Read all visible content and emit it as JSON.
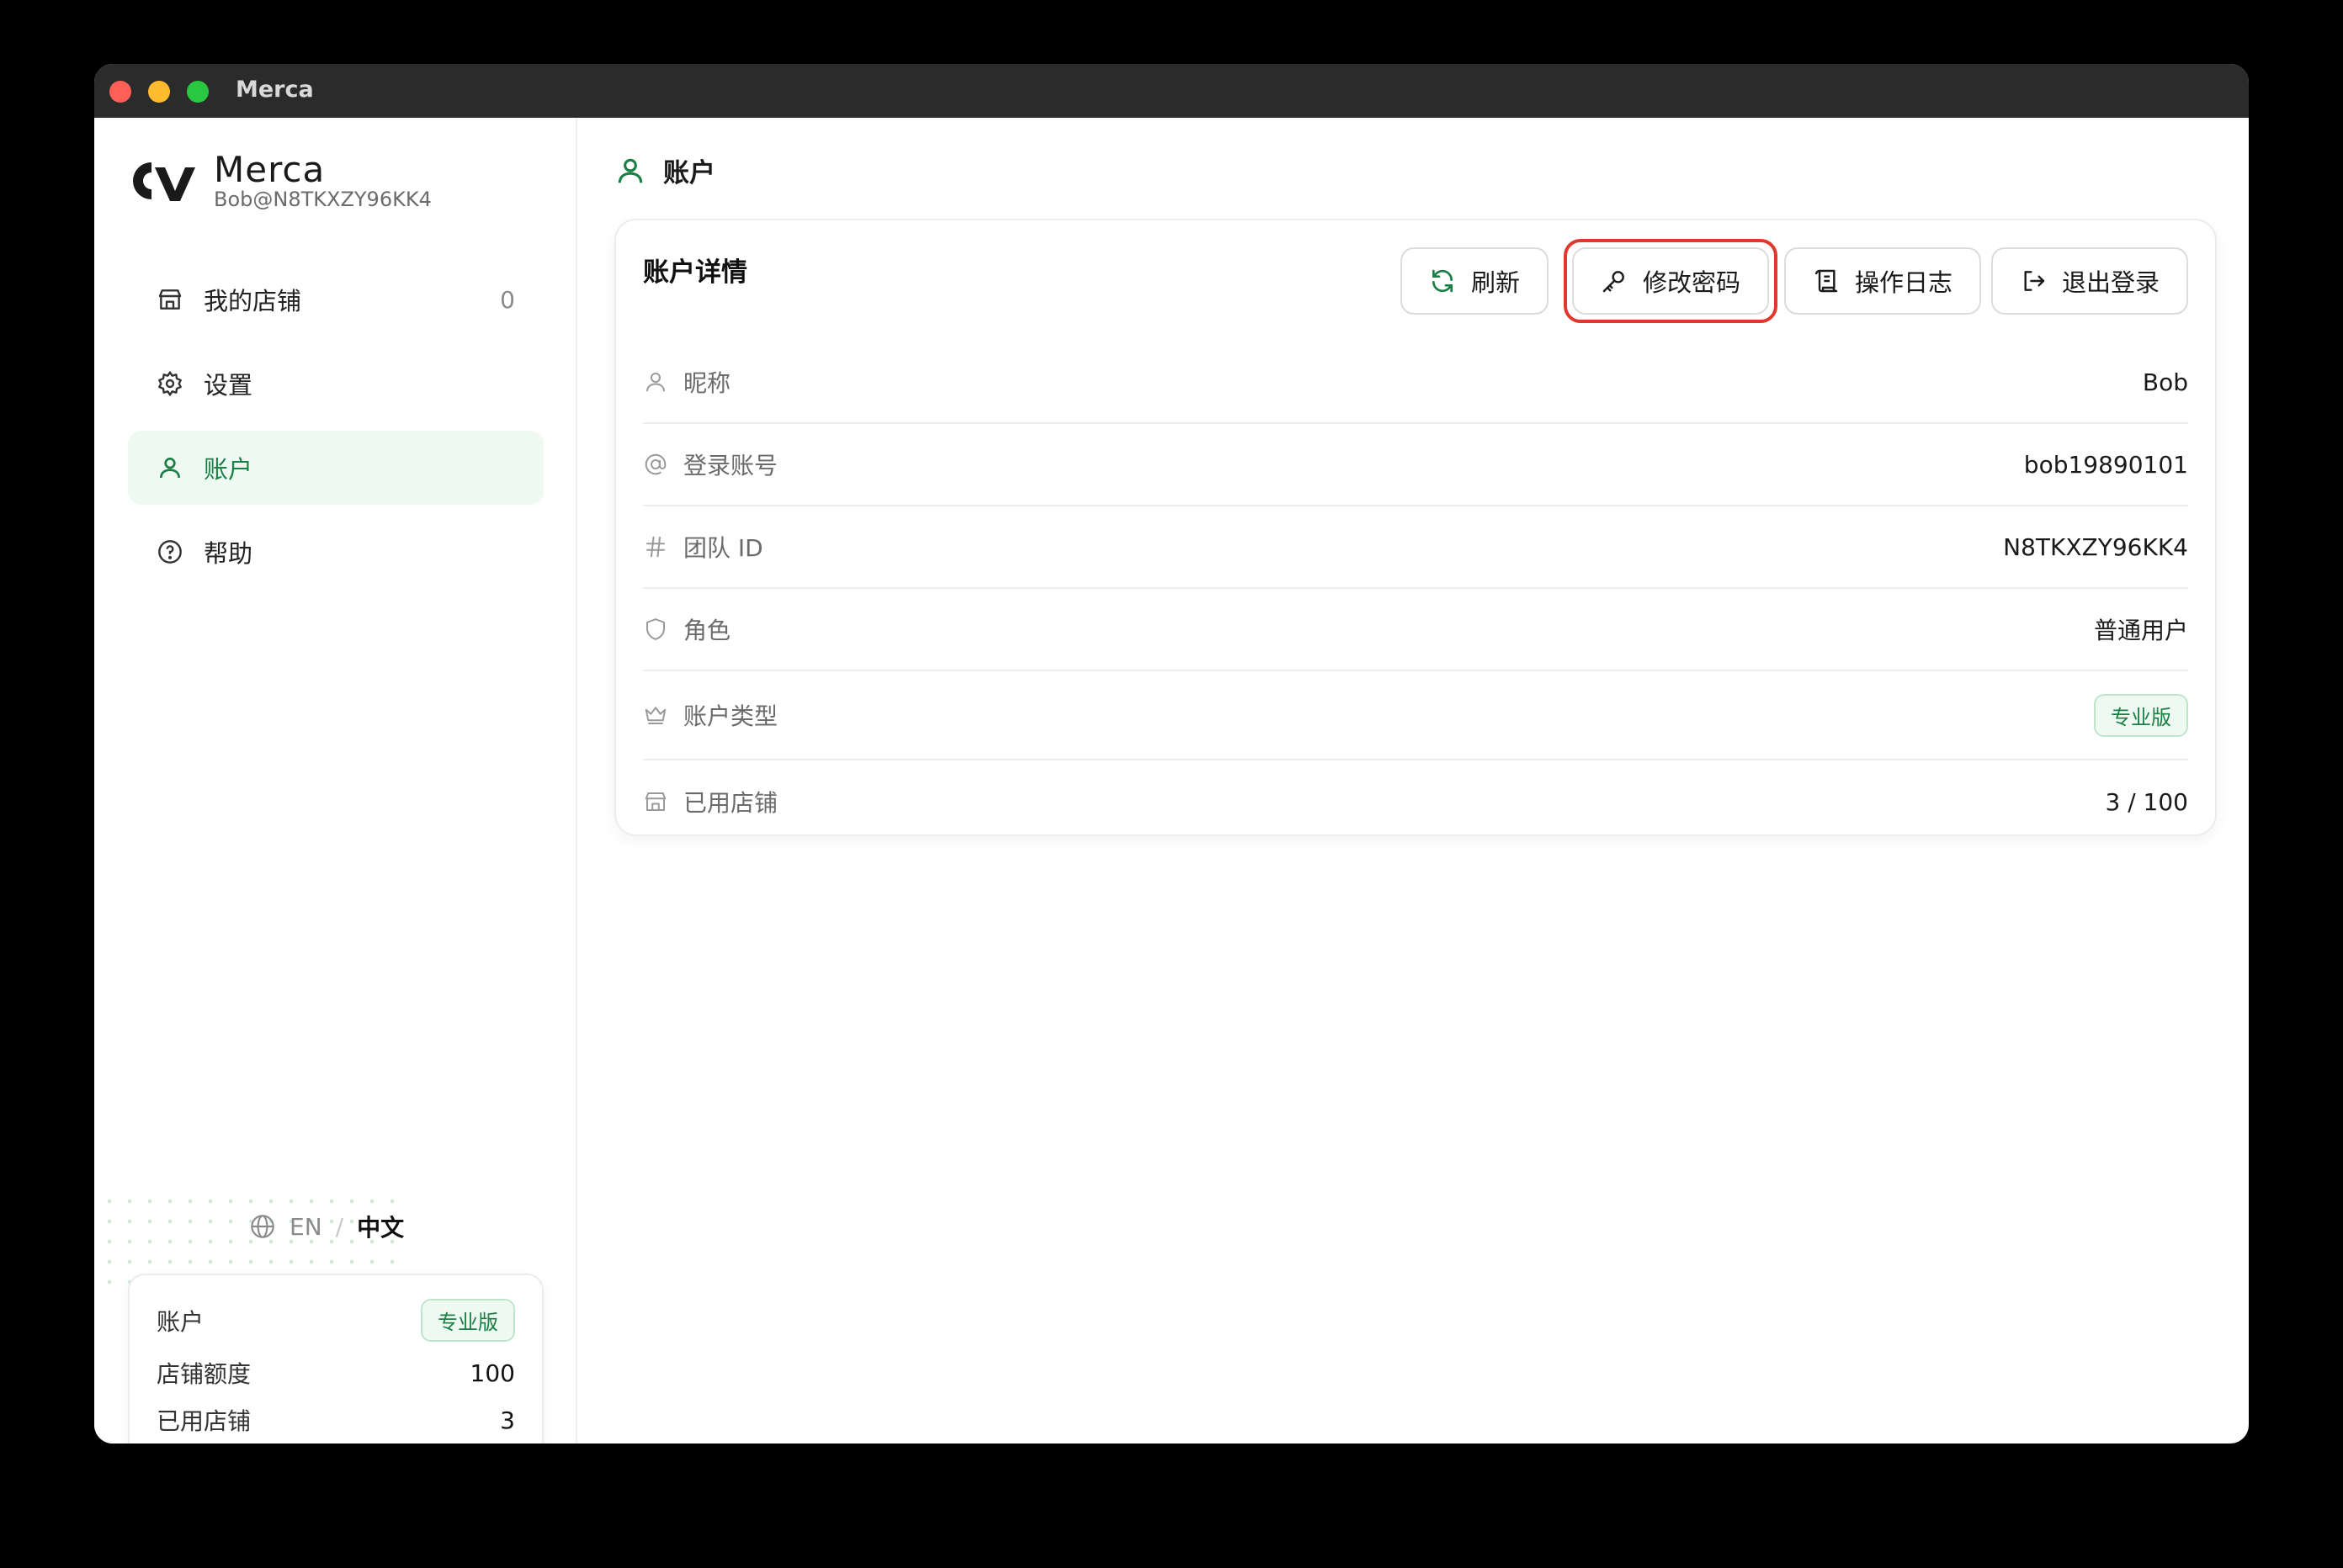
{
  "window": {
    "title": "Merca"
  },
  "brand": {
    "name": "Merca",
    "user": "Bob@N8TKXZY96KK4"
  },
  "sidebar": {
    "items": [
      {
        "label": "我的店铺",
        "count": "0",
        "icon": "store-icon"
      },
      {
        "label": "设置",
        "icon": "gear-icon"
      },
      {
        "label": "账户",
        "icon": "user-icon",
        "active": true
      },
      {
        "label": "帮助",
        "icon": "help-circle-icon"
      }
    ],
    "lang": {
      "en": "EN",
      "sep": "/",
      "zh": "中文"
    },
    "account_card": {
      "label": "账户",
      "badge": "专业版",
      "quota_label": "店铺额度",
      "quota_value": "100",
      "used_label": "已用店铺",
      "used_value": "3"
    }
  },
  "main": {
    "header_title": "账户",
    "panel_title": "账户详情",
    "buttons": {
      "refresh": "刷新",
      "change_password": "修改密码",
      "logs": "操作日志",
      "logout": "退出登录"
    },
    "rows": [
      {
        "label": "昵称",
        "value": "Bob",
        "icon": "user-icon"
      },
      {
        "label": "登录账号",
        "value": "bob19890101",
        "icon": "at-icon"
      },
      {
        "label": "团队 ID",
        "value": "N8TKXZY96KK4",
        "icon": "hash-icon"
      },
      {
        "label": "角色",
        "value": "普通用户",
        "icon": "shield-icon"
      },
      {
        "label": "账户类型",
        "value": "专业版",
        "icon": "crown-icon"
      },
      {
        "label": "已用店铺",
        "value": "3 / 100",
        "icon": "store-icon"
      }
    ]
  },
  "colors": {
    "accent": "#1a7f45",
    "accent_bg": "#eef9f2",
    "highlight": "#e0382b"
  }
}
